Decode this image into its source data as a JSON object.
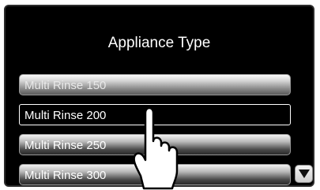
{
  "screen": {
    "title": "Appliance Type"
  },
  "list": {
    "items": [
      {
        "label": "Multi Rinse 150"
      },
      {
        "label": "Multi Rinse 200"
      },
      {
        "label": "Multi Rinse 250"
      },
      {
        "label": "Multi Rinse 300"
      }
    ],
    "selected_index": 1
  },
  "icons": {
    "scroll_down": "triangle-down-icon",
    "pointer": "hand-pointer-icon"
  },
  "colors": {
    "screen_bg": "#000000",
    "text": "#ffffff",
    "item_top": "#f2f2f2",
    "item_bottom": "#2a2a2a"
  }
}
